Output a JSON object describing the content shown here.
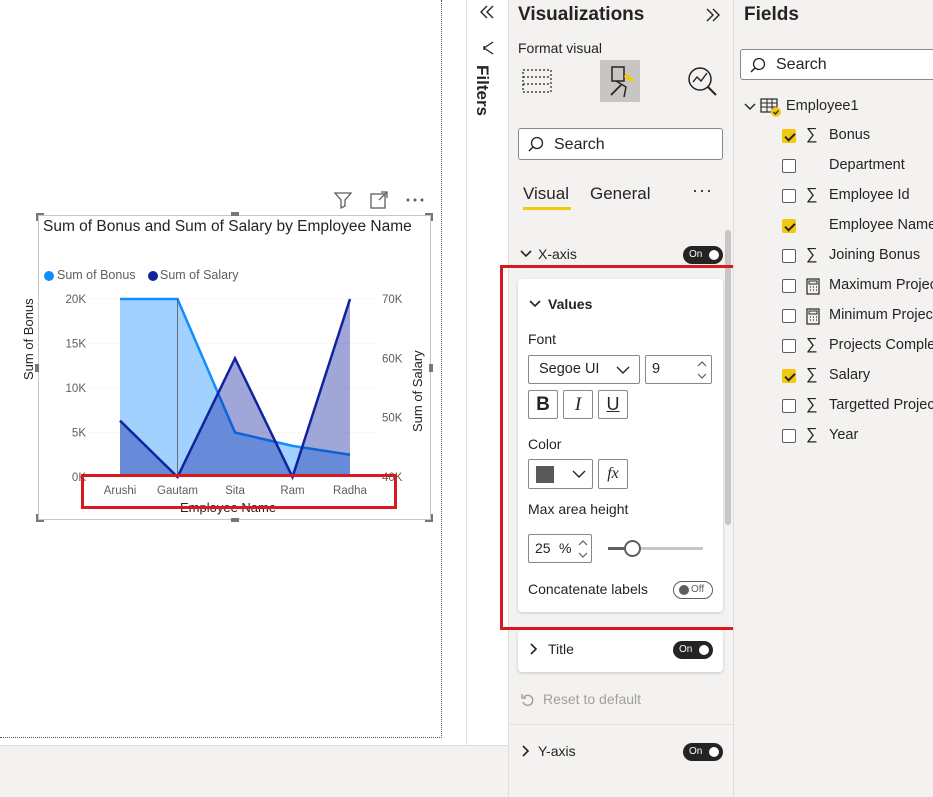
{
  "colors": {
    "bonus_series": "#118DFF",
    "salary_series": "#12239E",
    "highlight": "#D71A21",
    "checkbox_on": "#F2C811"
  },
  "filters_pane": {
    "label": "Filters"
  },
  "visualizations": {
    "title": "Visualizations",
    "subtitle": "Format visual",
    "search_placeholder": "Search",
    "tabs": [
      {
        "label": "Visual",
        "selected": true
      },
      {
        "label": "General",
        "selected": false
      }
    ],
    "more_label": "···",
    "x_axis": {
      "label": "X-axis",
      "toggle": "On"
    },
    "values": {
      "label": "Values",
      "font_label": "Font",
      "font_family": "Segoe UI",
      "font_size": "9",
      "bold": "B",
      "italic": "I",
      "underline": "U",
      "color_label": "Color",
      "color_value": "#595959",
      "fx_label": "fx",
      "max_area_label": "Max area height",
      "max_area_value": "25",
      "max_area_unit": "%",
      "max_area_slider_percent": 25,
      "concat_label": "Concatenate labels",
      "concat_toggle": "Off"
    },
    "title_section": {
      "label": "Title",
      "toggle": "On"
    },
    "reset_label": "Reset to default",
    "y_axis": {
      "label": "Y-axis",
      "toggle": "On"
    }
  },
  "fields": {
    "title": "Fields",
    "search_placeholder": "Search",
    "table_name": "Employee1",
    "items": [
      {
        "name": "Bonus",
        "checked": true,
        "sigma": true
      },
      {
        "name": "Department",
        "checked": false,
        "sigma": false
      },
      {
        "name": "Employee Id",
        "checked": false,
        "sigma": true
      },
      {
        "name": "Employee Name",
        "checked": true,
        "sigma": false
      },
      {
        "name": "Joining Bonus",
        "checked": false,
        "sigma": true
      },
      {
        "name": "Maximum Projects",
        "checked": false,
        "calc": true
      },
      {
        "name": "Minimum Projects",
        "checked": false,
        "calc": true
      },
      {
        "name": "Projects Completed",
        "checked": false,
        "sigma": true
      },
      {
        "name": "Salary",
        "checked": true,
        "sigma": true
      },
      {
        "name": "Targetted Projects",
        "checked": false,
        "sigma": true
      },
      {
        "name": "Year",
        "checked": false,
        "sigma": true
      }
    ]
  },
  "chart_data": {
    "type": "area",
    "title": "Sum of Bonus and Sum of Salary by Employee Name",
    "categories": [
      "Arushi",
      "Gautam",
      "Sita",
      "Ram",
      "Radha"
    ],
    "xlabel": "Employee Name",
    "ylabel": "Sum of Bonus",
    "y2label": "Sum of Salary",
    "ylim": [
      0,
      20000
    ],
    "y2lim": [
      40000,
      70000
    ],
    "yticks": [
      "0K",
      "5K",
      "10K",
      "15K",
      "20K"
    ],
    "y2ticks": [
      "40K",
      "50K",
      "60K",
      "70K"
    ],
    "legend_position": "top-left",
    "series": [
      {
        "name": "Sum of Bonus",
        "axis": "left",
        "values": [
          20000,
          20000,
          5000,
          3500,
          2500
        ]
      },
      {
        "name": "Sum of Salary",
        "axis": "right",
        "values": [
          49500,
          40000,
          60000,
          40000,
          70000
        ]
      }
    ]
  }
}
